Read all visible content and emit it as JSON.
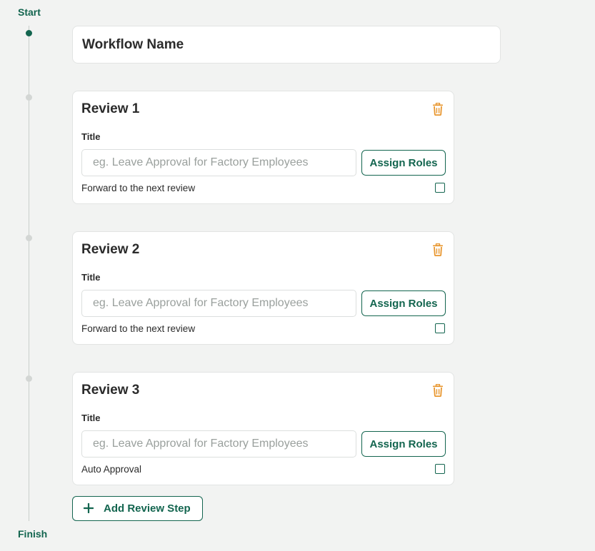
{
  "timeline": {
    "start_label": "Start",
    "finish_label": "Finish"
  },
  "workflow": {
    "name": "Workflow Name"
  },
  "reviews": [
    {
      "title": "Review 1",
      "field_label": "Title",
      "input_placeholder": "eg. Leave Approval for Factory Employees",
      "input_value": "",
      "assign_label": "Assign Roles",
      "checkbox_label": "Forward to the next review",
      "checked": false
    },
    {
      "title": "Review 2",
      "field_label": "Title",
      "input_placeholder": "eg. Leave Approval for Factory Employees",
      "input_value": "",
      "assign_label": "Assign Roles",
      "checkbox_label": "Forward to the next review",
      "checked": false
    },
    {
      "title": "Review 3",
      "field_label": "Title",
      "input_placeholder": "eg. Leave Approval for Factory Employees",
      "input_value": "",
      "assign_label": "Assign Roles",
      "checkbox_label": "Auto Approval",
      "checked": false
    }
  ],
  "add_step": {
    "label": "Add Review Step",
    "icon": "plus-icon"
  },
  "icons": {
    "delete": "trash-icon"
  },
  "colors": {
    "accent": "#13654f",
    "delete": "#e8962e",
    "background": "#f2f3f2"
  }
}
